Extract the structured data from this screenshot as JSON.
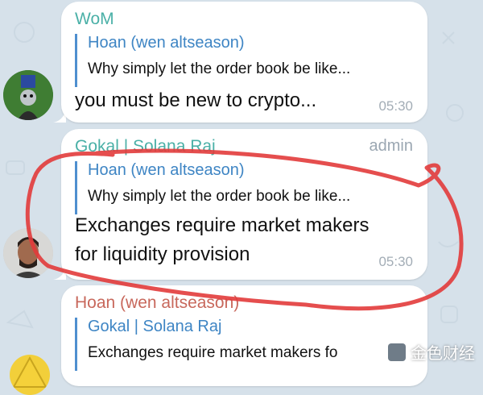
{
  "messages": [
    {
      "sender": "WoM",
      "sender_color": "#4ab0a7",
      "reply": {
        "name": "Hoan (wen altseason)",
        "text": "Why simply let the order book be like..."
      },
      "lines": [
        "you must be new to crypto..."
      ],
      "time": "05:30"
    },
    {
      "sender": "Gokal | Solana Raj",
      "sender_color": "#4ab0a7",
      "badge": "admin",
      "reply": {
        "name": "Hoan (wen altseason)",
        "text": "Why simply let the order book be like..."
      },
      "lines": [
        "Exchanges require market makers",
        "for liquidity provision"
      ],
      "time": "05:30"
    },
    {
      "sender": "Hoan (wen altseason)",
      "sender_color": "#c8685c",
      "reply": {
        "name": "Gokal | Solana Raj",
        "text": "Exchanges require market makers fo"
      }
    }
  ],
  "annotation_color": "#e23b3b",
  "watermark": "金色财经"
}
